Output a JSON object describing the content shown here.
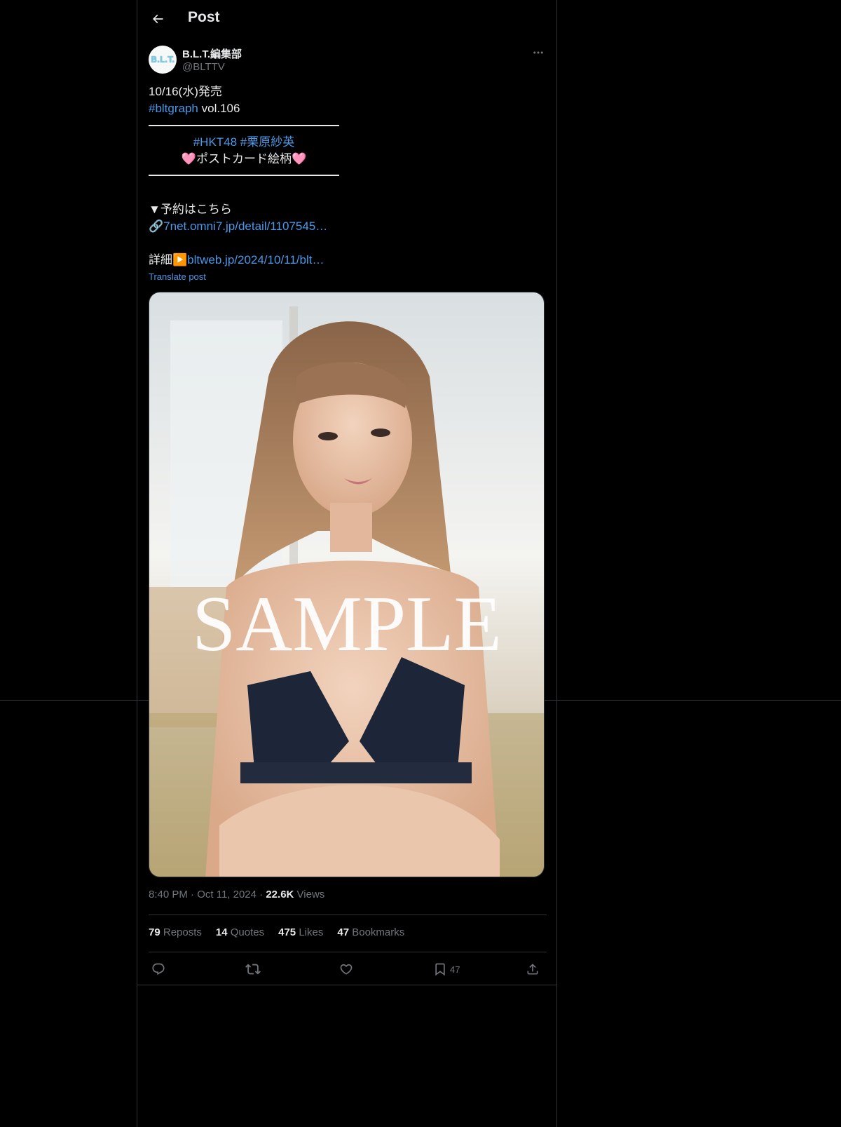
{
  "header": {
    "title": "Post"
  },
  "author": {
    "avatar_text": "B.L.T.",
    "name": "B.L.T.編集部",
    "handle": "@BLTTV"
  },
  "post": {
    "line1": "10/16(水)発売",
    "hashtag1": "#bltgraph",
    "line2_rest": " vol.106",
    "hashtags_center": "#HKT48 #栗原紗英",
    "postcard_line": "🩷ポストカード絵柄🩷",
    "reserve_label": "▼予約はこちら",
    "reserve_prefix": "🔗",
    "reserve_link": "7net.omni7.jp/detail/1107545…",
    "detail_label": "詳細▶️",
    "detail_link": "bltweb.jp/2024/10/11/blt…",
    "translate": "Translate post"
  },
  "photo": {
    "watermark": "SAMPLE"
  },
  "meta": {
    "time": "8:40 PM",
    "sep": "·",
    "date": "Oct 11, 2024",
    "views_count": "22.6K",
    "views_label": "Views"
  },
  "stats": [
    {
      "count": "79",
      "label": "Reposts"
    },
    {
      "count": "14",
      "label": "Quotes"
    },
    {
      "count": "475",
      "label": "Likes"
    },
    {
      "count": "47",
      "label": "Bookmarks"
    }
  ],
  "actions": {
    "bookmark_count": "47"
  },
  "icons": [
    "back-arrow-icon",
    "more-icon",
    "reply-icon",
    "repost-icon",
    "like-icon",
    "bookmark-icon",
    "share-icon"
  ],
  "colors": {
    "background": "#000000",
    "text": "#e7e9ea",
    "muted": "#71767b",
    "link": "#4a99e9",
    "border": "#2f3336"
  }
}
